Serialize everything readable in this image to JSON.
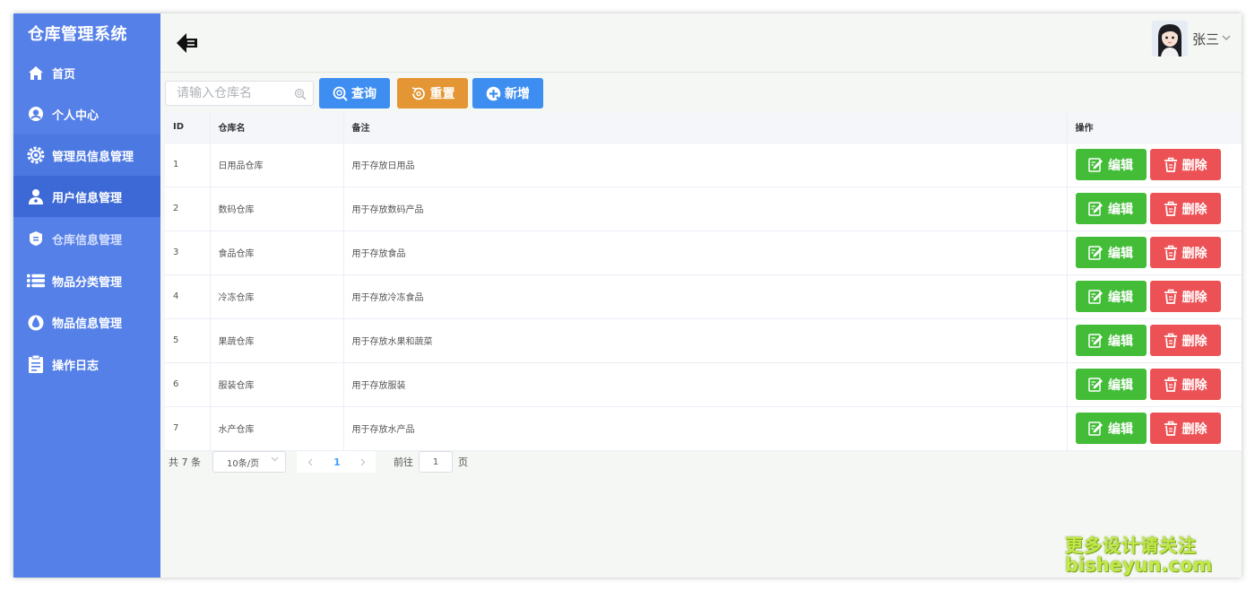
{
  "app": {
    "title": "仓库管理系统"
  },
  "sidebar": {
    "items": [
      {
        "label": "首页",
        "icon": "home-icon"
      },
      {
        "label": "个人中心",
        "icon": "user-circle-icon"
      },
      {
        "label": "管理员信息管理",
        "icon": "gear-icon"
      },
      {
        "label": "用户信息管理",
        "icon": "user-icon"
      },
      {
        "label": "仓库信息管理",
        "icon": "warehouse-icon"
      },
      {
        "label": "物品分类管理",
        "icon": "list-icon"
      },
      {
        "label": "物品信息管理",
        "icon": "drop-icon"
      },
      {
        "label": "操作日志",
        "icon": "clipboard-icon"
      }
    ]
  },
  "header": {
    "user_name": "张三"
  },
  "toolbar": {
    "search_placeholder": "请输入仓库名",
    "query_label": "查询",
    "reset_label": "重置",
    "add_label": "新增"
  },
  "table": {
    "columns": [
      "ID",
      "仓库名",
      "备注",
      "操作"
    ],
    "rows": [
      {
        "id": "1",
        "name": "日用品仓库",
        "note": "用于存放日用品"
      },
      {
        "id": "2",
        "name": "数码仓库",
        "note": "用于存放数码产品"
      },
      {
        "id": "3",
        "name": "食品仓库",
        "note": "用于存放食品"
      },
      {
        "id": "4",
        "name": "冷冻仓库",
        "note": "用于存放冷冻食品"
      },
      {
        "id": "5",
        "name": "果蔬仓库",
        "note": "用于存放水果和蔬菜"
      },
      {
        "id": "6",
        "name": "服装仓库",
        "note": "用于存放服装"
      },
      {
        "id": "7",
        "name": "水产仓库",
        "note": "用于存放水产品"
      }
    ],
    "edit_label": "编辑",
    "delete_label": "删除"
  },
  "pager": {
    "total_text": "共 7 条",
    "page_size": "10条/页",
    "current_page": "1",
    "goto_label": "前往",
    "goto_value": "1",
    "page_suffix": "页"
  },
  "watermark": {
    "line1": "更多设计请关注",
    "line2": "bisheyun.com"
  },
  "colors": {
    "sidebar": "#5580e8",
    "primary": "#3d8ef0",
    "warning": "#e39633",
    "success": "#43bd38",
    "danger": "#ec5255"
  }
}
